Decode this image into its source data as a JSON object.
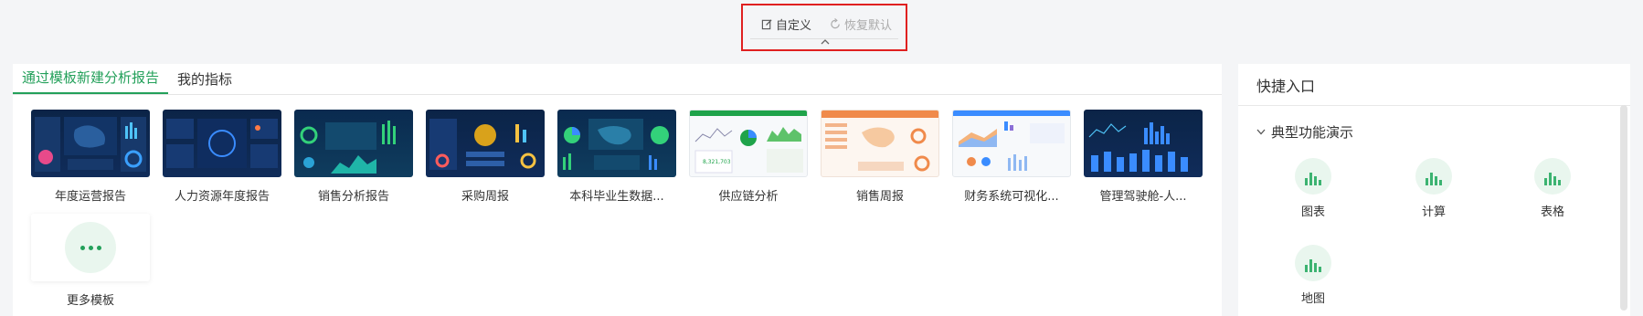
{
  "toolbar": {
    "customize_label": "自定义",
    "restore_label": "恢复默认"
  },
  "tabs": [
    {
      "label": "通过模板新建分析报告",
      "active": true
    },
    {
      "label": "我的指标",
      "active": false
    }
  ],
  "templates": [
    {
      "label": "年度运营报告",
      "style": "dark"
    },
    {
      "label": "人力资源年度报告",
      "style": "dark"
    },
    {
      "label": "销售分析报告",
      "style": "dark"
    },
    {
      "label": "采购周报",
      "style": "dark"
    },
    {
      "label": "本科毕业生数据...",
      "style": "dark"
    },
    {
      "label": "供应链分析",
      "style": "light"
    },
    {
      "label": "销售周报",
      "style": "light2"
    },
    {
      "label": "财务系统可视化...",
      "style": "light"
    },
    {
      "label": "管理驾驶舱-人...",
      "style": "dark"
    }
  ],
  "more_templates_label": "更多模板",
  "quick_entry": {
    "title": "快捷入口",
    "section": "典型功能演示",
    "items": [
      {
        "label": "图表"
      },
      {
        "label": "计算"
      },
      {
        "label": "表格"
      },
      {
        "label": "地图"
      }
    ]
  },
  "colors": {
    "accent": "#23a05a",
    "highlight_border": "#e02020"
  }
}
